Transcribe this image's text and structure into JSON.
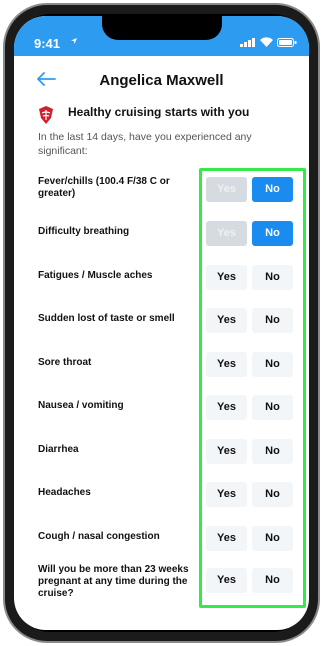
{
  "status_bar": {
    "time": "9:41",
    "icons": [
      "location-icon",
      "signal-icon",
      "wifi-icon",
      "battery-icon"
    ]
  },
  "header": {
    "back_icon": "back-arrow-icon",
    "title": "Angelica Maxwell"
  },
  "banner": {
    "logo_icon": "brand-logo-icon",
    "heading": "Healthy cruising starts with you"
  },
  "intro": "In the last 14 days, have you experienced any significant:",
  "answer_labels": {
    "yes": "Yes",
    "no": "No"
  },
  "questions": [
    {
      "label": "Fever/chills (100.4 F/38 C or greater)",
      "selected": "No",
      "yes_disabled": true
    },
    {
      "label": "Difficulty breathing",
      "selected": "No",
      "yes_disabled": true
    },
    {
      "label": "Fatigues / Muscle aches",
      "selected": null,
      "yes_disabled": false
    },
    {
      "label": "Sudden lost of taste or smell",
      "selected": null,
      "yes_disabled": false
    },
    {
      "label": "Sore throat",
      "selected": null,
      "yes_disabled": false
    },
    {
      "label": "Nausea / vomiting",
      "selected": null,
      "yes_disabled": false
    },
    {
      "label": "Diarrhea",
      "selected": null,
      "yes_disabled": false
    },
    {
      "label": "Headaches",
      "selected": null,
      "yes_disabled": false
    },
    {
      "label": "Cough / nasal congestion",
      "selected": null,
      "yes_disabled": false
    },
    {
      "label": "Will you be more than 23 weeks pregnant at any time during the cruise?",
      "selected": null,
      "yes_disabled": false
    }
  ],
  "colors": {
    "status_bar": "#2d9cf0",
    "accent_blue": "#1a8cf0",
    "highlight_green": "#37e84b",
    "button_bg": "#f3f6f9",
    "button_disabled": "#d5dbe1",
    "brand_red": "#d02030"
  }
}
